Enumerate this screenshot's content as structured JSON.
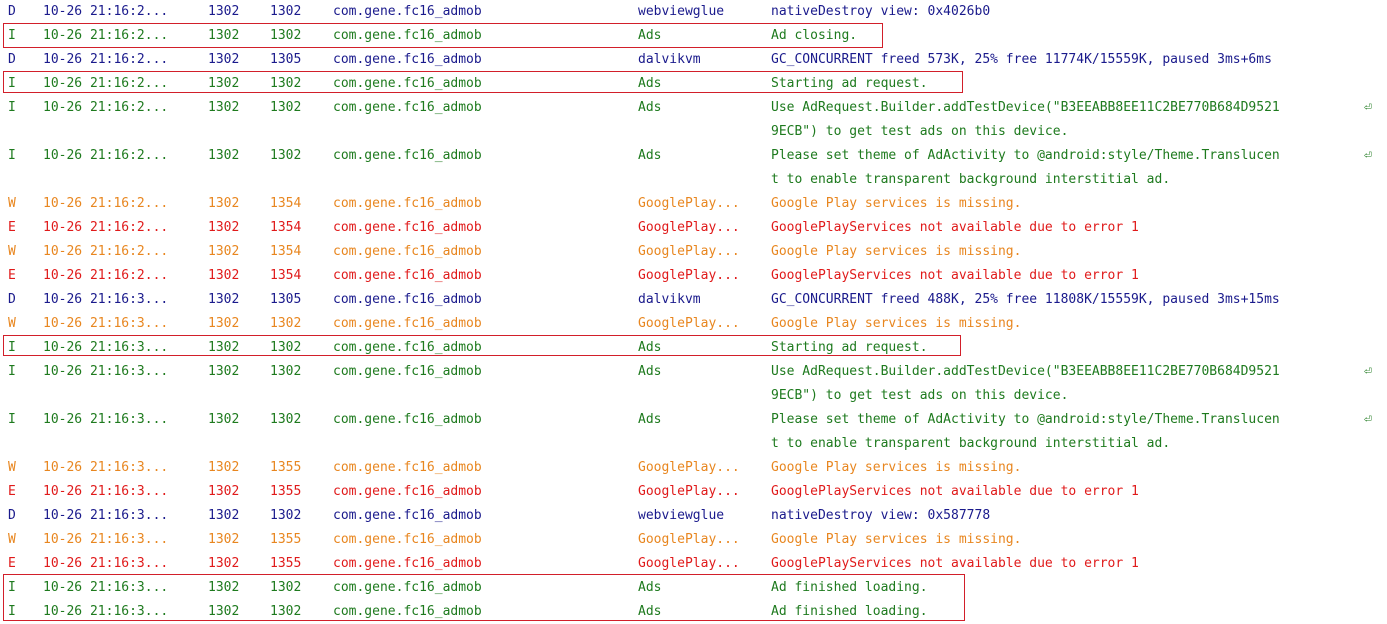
{
  "colors": {
    "debug": "#1a1a8c",
    "info": "#1e7a1e",
    "warn": "#e8861f",
    "error": "#e01a1a",
    "highlight": "#d21f2a"
  },
  "wrap_glyph": "⏎",
  "rows": [
    {
      "lvl": "D",
      "time": "10-26 21:16:2...",
      "pid": "1302",
      "tid": "1302",
      "app": "com.gene.fc16_admob",
      "tag": "webviewglue",
      "msg": "nativeDestroy view: 0x4026b0"
    },
    {
      "lvl": "I",
      "time": "10-26 21:16:2...",
      "pid": "1302",
      "tid": "1302",
      "app": "com.gene.fc16_admob",
      "tag": "Ads",
      "msg": "Ad closing."
    },
    {
      "lvl": "D",
      "time": "10-26 21:16:2...",
      "pid": "1302",
      "tid": "1305",
      "app": "com.gene.fc16_admob",
      "tag": "dalvikvm",
      "msg": "GC_CONCURRENT freed 573K, 25% free 11774K/15559K, paused 3ms+6ms"
    },
    {
      "lvl": "I",
      "time": "10-26 21:16:2...",
      "pid": "1302",
      "tid": "1302",
      "app": "com.gene.fc16_admob",
      "tag": "Ads",
      "msg": "Starting ad request."
    },
    {
      "lvl": "I",
      "time": "10-26 21:16:2...",
      "pid": "1302",
      "tid": "1302",
      "app": "com.gene.fc16_admob",
      "tag": "Ads",
      "msg": "Use AdRequest.Builder.addTestDevice(\"B3EEABB8EE11C2BE770B684D9521",
      "wrap": true
    },
    {
      "lvl": "I",
      "cont": true,
      "msg": "9ECB\") to get test ads on this device."
    },
    {
      "lvl": "I",
      "time": "10-26 21:16:2...",
      "pid": "1302",
      "tid": "1302",
      "app": "com.gene.fc16_admob",
      "tag": "Ads",
      "msg": "Please set theme of AdActivity to @android:style/Theme.Translucen",
      "wrap": true
    },
    {
      "lvl": "I",
      "cont": true,
      "msg": "t to enable transparent background interstitial ad."
    },
    {
      "lvl": "W",
      "time": "10-26 21:16:2...",
      "pid": "1302",
      "tid": "1354",
      "app": "com.gene.fc16_admob",
      "tag": "GooglePlay...",
      "msg": "Google Play services is missing."
    },
    {
      "lvl": "E",
      "time": "10-26 21:16:2...",
      "pid": "1302",
      "tid": "1354",
      "app": "com.gene.fc16_admob",
      "tag": "GooglePlay...",
      "msg": "GooglePlayServices not available due to error 1"
    },
    {
      "lvl": "W",
      "time": "10-26 21:16:2...",
      "pid": "1302",
      "tid": "1354",
      "app": "com.gene.fc16_admob",
      "tag": "GooglePlay...",
      "msg": "Google Play services is missing."
    },
    {
      "lvl": "E",
      "time": "10-26 21:16:2...",
      "pid": "1302",
      "tid": "1354",
      "app": "com.gene.fc16_admob",
      "tag": "GooglePlay...",
      "msg": "GooglePlayServices not available due to error 1"
    },
    {
      "lvl": "D",
      "time": "10-26 21:16:3...",
      "pid": "1302",
      "tid": "1305",
      "app": "com.gene.fc16_admob",
      "tag": "dalvikvm",
      "msg": "GC_CONCURRENT freed 488K, 25% free 11808K/15559K, paused 3ms+15ms"
    },
    {
      "lvl": "W",
      "time": "10-26 21:16:3...",
      "pid": "1302",
      "tid": "1302",
      "app": "com.gene.fc16_admob",
      "tag": "GooglePlay...",
      "msg": "Google Play services is missing."
    },
    {
      "lvl": "I",
      "time": "10-26 21:16:3...",
      "pid": "1302",
      "tid": "1302",
      "app": "com.gene.fc16_admob",
      "tag": "Ads",
      "msg": "Starting ad request."
    },
    {
      "lvl": "I",
      "time": "10-26 21:16:3...",
      "pid": "1302",
      "tid": "1302",
      "app": "com.gene.fc16_admob",
      "tag": "Ads",
      "msg": "Use AdRequest.Builder.addTestDevice(\"B3EEABB8EE11C2BE770B684D9521",
      "wrap": true
    },
    {
      "lvl": "I",
      "cont": true,
      "msg": "9ECB\") to get test ads on this device."
    },
    {
      "lvl": "I",
      "time": "10-26 21:16:3...",
      "pid": "1302",
      "tid": "1302",
      "app": "com.gene.fc16_admob",
      "tag": "Ads",
      "msg": "Please set theme of AdActivity to @android:style/Theme.Translucen",
      "wrap": true
    },
    {
      "lvl": "I",
      "cont": true,
      "msg": "t to enable transparent background interstitial ad."
    },
    {
      "lvl": "W",
      "time": "10-26 21:16:3...",
      "pid": "1302",
      "tid": "1355",
      "app": "com.gene.fc16_admob",
      "tag": "GooglePlay...",
      "msg": "Google Play services is missing."
    },
    {
      "lvl": "E",
      "time": "10-26 21:16:3...",
      "pid": "1302",
      "tid": "1355",
      "app": "com.gene.fc16_admob",
      "tag": "GooglePlay...",
      "msg": "GooglePlayServices not available due to error 1"
    },
    {
      "lvl": "D",
      "time": "10-26 21:16:3...",
      "pid": "1302",
      "tid": "1302",
      "app": "com.gene.fc16_admob",
      "tag": "webviewglue",
      "msg": "nativeDestroy view: 0x587778"
    },
    {
      "lvl": "W",
      "time": "10-26 21:16:3...",
      "pid": "1302",
      "tid": "1355",
      "app": "com.gene.fc16_admob",
      "tag": "GooglePlay...",
      "msg": "Google Play services is missing."
    },
    {
      "lvl": "E",
      "time": "10-26 21:16:3...",
      "pid": "1302",
      "tid": "1355",
      "app": "com.gene.fc16_admob",
      "tag": "GooglePlay...",
      "msg": "GooglePlayServices not available due to error 1"
    },
    {
      "lvl": "I",
      "time": "10-26 21:16:3...",
      "pid": "1302",
      "tid": "1302",
      "app": "com.gene.fc16_admob",
      "tag": "Ads",
      "msg": "Ad finished loading."
    },
    {
      "lvl": "I",
      "time": "10-26 21:16:3...",
      "pid": "1302",
      "tid": "1302",
      "app": "com.gene.fc16_admob",
      "tag": "Ads",
      "msg": "Ad finished loading."
    }
  ]
}
